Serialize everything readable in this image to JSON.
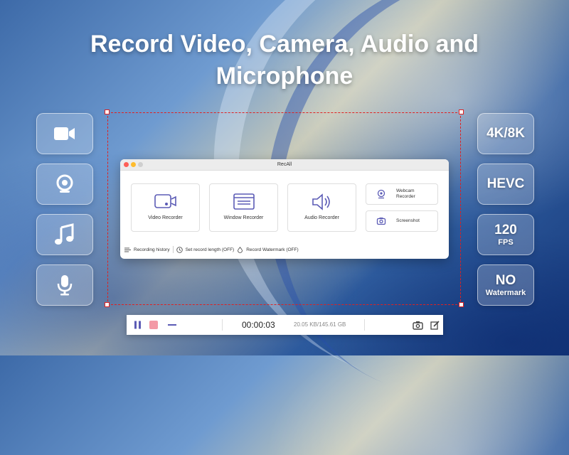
{
  "headline": {
    "line1": "Record Video, Camera, Audio and",
    "line2": "Microphone"
  },
  "left_tiles": [
    {
      "icon": "video-camera-icon"
    },
    {
      "icon": "webcam-icon"
    },
    {
      "icon": "music-note-icon"
    },
    {
      "icon": "microphone-icon"
    }
  ],
  "features": [
    {
      "main": "4K/8K",
      "sub": ""
    },
    {
      "main": "HEVC",
      "sub": ""
    },
    {
      "main": "120",
      "sub": "FPS"
    },
    {
      "main": "NO",
      "sub": "Watermark"
    }
  ],
  "app": {
    "title": "RecAll",
    "cards": {
      "video": "Video Recorder",
      "window": "Window Recorder",
      "audio": "Audio Recorder",
      "webcam_line1": "Webcam",
      "webcam_line2": "Recorder",
      "screenshot": "Screenshot"
    },
    "bottom": {
      "history": "Recording history",
      "length": "Set record length (OFF)",
      "watermark": "Record Watermark (OFF)"
    }
  },
  "recbar": {
    "timer": "00:00:03",
    "size": "20.05 KB/145.61 GB"
  },
  "colors": {
    "accent_purple": "#5b5bb5",
    "selection_red": "#e02020",
    "stop_pink": "#f39aa6"
  }
}
